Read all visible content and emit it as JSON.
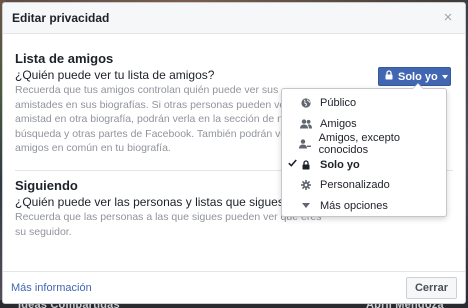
{
  "background": {
    "bottom_text_left": "Ideas Compartidas",
    "bottom_text_right": "Abril Mendoza"
  },
  "dialog": {
    "title": "Editar privacidad",
    "close_glyph": "×"
  },
  "friends_section": {
    "title": "Lista de amigos",
    "question": "¿Quién puede ver tu lista de amigos?",
    "help_lines": [
      "Recuerda que tus amigos controlan quién puede ver sus",
      "amistades en sus biografías. Si otras personas pueden ver tu",
      "amistad en otra biografía, podrán verla en la sección de noticias,",
      "búsqueda y otras partes de Facebook. También podrán ver los",
      "amigos en común en tu biografía."
    ]
  },
  "following_section": {
    "title": "Siguiendo",
    "question": "¿Quién puede ver las personas y listas que sigues?",
    "help_lines": [
      "Recuerda que las personas a las que sigues pueden ver que eres",
      "su seguidor."
    ]
  },
  "audience_button": {
    "label": "Solo yo",
    "icon": "lock-icon",
    "color": "#4267b2"
  },
  "menu": {
    "items": [
      {
        "label": "Público",
        "icon": "globe-icon",
        "selected": false
      },
      {
        "label": "Amigos",
        "icon": "friends-icon",
        "selected": false
      },
      {
        "label": "Amigos, excepto conocidos",
        "icon": "friends-except-icon",
        "selected": false
      },
      {
        "label": "Solo yo",
        "icon": "lock-icon",
        "selected": true
      },
      {
        "label": "Personalizado",
        "icon": "gear-icon",
        "selected": false
      },
      {
        "label": "Más opciones",
        "icon": "caret-down-icon",
        "selected": false
      }
    ]
  },
  "footer": {
    "more_info": "Más información",
    "close_label": "Cerrar"
  }
}
